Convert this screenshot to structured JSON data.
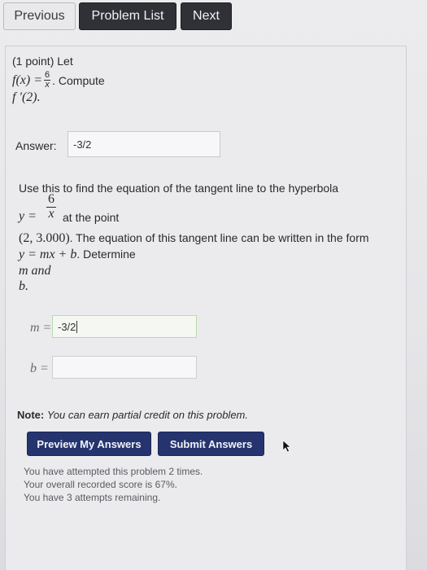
{
  "nav": {
    "previous_label": "Previous",
    "problem_list_label": "Problem List",
    "next_label": "Next"
  },
  "problem": {
    "line1": "(1 point) Let",
    "f_def_prefix": "f(x) =",
    "f_num": "6",
    "f_den": "x",
    "f_def_suffix": ". Compute",
    "line3": "f ′(2).",
    "answer_label": "Answer:",
    "answer_value": "-3/2",
    "tangent_intro": "Use this to find the equation of the tangent line to the hyperbola",
    "y_prefix": "y =",
    "y_num": "6",
    "y_den": "x",
    "at_point": "at the point",
    "point": "(2, 3.000)",
    "tangent_rest": ". The equation of this tangent line can be written in the form",
    "form": "y = mx + b",
    "determine": ". Determine",
    "m_and": "m and",
    "b_dot": "b.",
    "m_label": "m =",
    "m_value": "-3/2",
    "b_label": "b =",
    "b_value": ""
  },
  "note": {
    "label": "Note:",
    "text": "You can earn partial credit on this problem."
  },
  "actions": {
    "preview_label": "Preview My Answers",
    "submit_label": "Submit Answers"
  },
  "status": {
    "attempts": "You have attempted this problem 2 times.",
    "score": "Your overall recorded score is 67%.",
    "remaining": "You have 3 attempts remaining."
  },
  "colors": {
    "nav_dark": "#2f3137",
    "action_blue": "#25346e",
    "answer_border": "#b8dba8"
  }
}
